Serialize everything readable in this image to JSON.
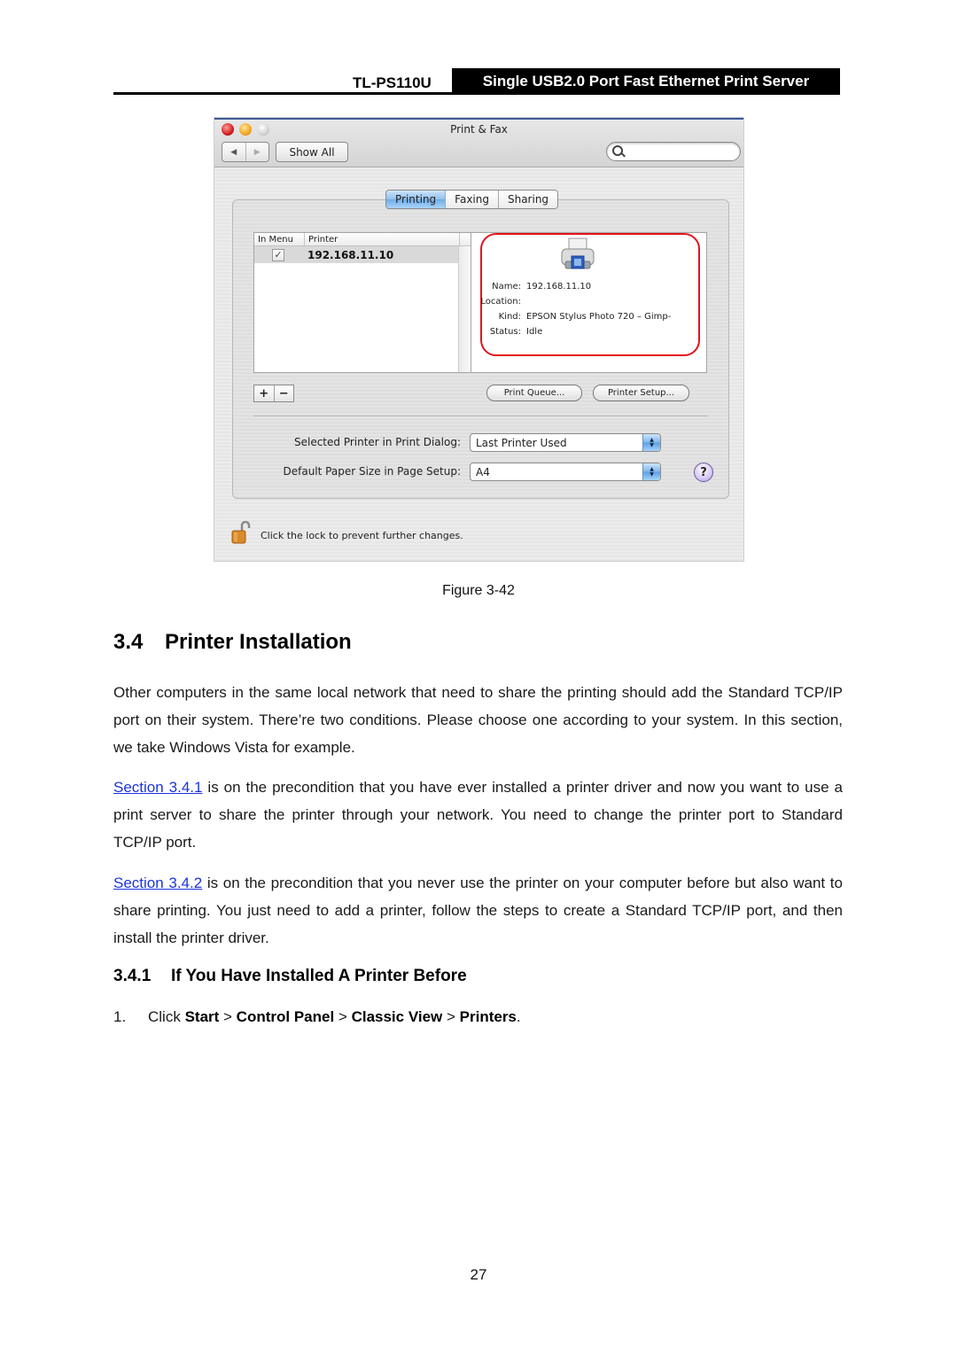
{
  "header": {
    "model": "TL-PS110U",
    "product": "Single USB2.0 Port Fast Ethernet Print Server"
  },
  "screenshot": {
    "window_title": "Print & Fax",
    "nav_back": "◀",
    "nav_forward": "▶",
    "show_all_label": "Show All",
    "search_placeholder": "",
    "tabs": [
      {
        "label": "Printing",
        "active": true
      },
      {
        "label": "Faxing",
        "active": false
      },
      {
        "label": "Sharing",
        "active": false
      }
    ],
    "printer_list": {
      "columns": [
        "In Menu",
        "Printer"
      ],
      "rows": [
        {
          "in_menu": "✓",
          "printer": "192.168.11.10",
          "selected": true
        }
      ]
    },
    "details": {
      "name_label": "Name:",
      "name": "192.168.11.10",
      "location_label": "Location:",
      "location": "",
      "kind_label": "Kind:",
      "kind": "EPSON Stylus Photo 720 – Gimp-",
      "status_label": "Status:",
      "status": "Idle",
      "highlight_color": "#e5121a"
    },
    "add_label": "+",
    "remove_label": "−",
    "print_queue_label": "Print Queue...",
    "printer_setup_label": "Printer Setup...",
    "selected_printer_label": "Selected Printer in Print Dialog:",
    "selected_printer_value": "Last Printer Used",
    "paper_size_label": "Default Paper Size in Page Setup:",
    "paper_size_value": "A4",
    "help_label": "?",
    "lock_text": "Click the lock to prevent further changes."
  },
  "figure_caption": "Figure 3-42",
  "section": {
    "number": "3.4",
    "title": "Printer Installation",
    "intro": "Other computers in the same local network that need to share the printing should add the Standard TCP/IP port on their system. There’re two conditions. Please choose one according to your system. In this section, we take Windows Vista for example.",
    "p1_link": "Section 3.4.1",
    "p1_text": " is on the precondition that you have ever installed a printer driver and now you want to use a print server to share the printer through your network. You need to change the printer port to Standard TCP/IP port.",
    "p2_link": "Section 3.4.2",
    "p2_text": " is on the precondition that you never use the printer on your computer before but also want to share printing. You just need to add a printer, follow the steps to create a Standard TCP/IP port, and then install the printer driver.",
    "link_color": "#1a34e0"
  },
  "subsection": {
    "number": "3.4.1",
    "title": "If You Have Installed A Printer Before"
  },
  "steps": [
    {
      "number": "1.",
      "prefix": "Click ",
      "start": "Start",
      "sep1": " > ",
      "control_panel": "Control Panel",
      "sep2": " > ",
      "classic_view": "Classic View",
      "sep3": " > ",
      "printers": "Printers",
      "suffix": "."
    }
  ],
  "page_number": "27"
}
